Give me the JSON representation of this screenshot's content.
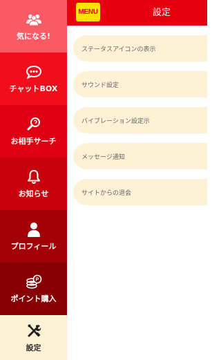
{
  "header": {
    "menu_label": "MENU",
    "title": "設定"
  },
  "colors": {
    "accent": "#e6000f",
    "menu_button": "#ffe100",
    "row_bg": "#fdf1d6",
    "active_nav_bg": "#fdf1d6"
  },
  "sidebar": {
    "items": [
      {
        "label": "気になる!",
        "icon": "people-icon",
        "bg": "#f95b65"
      },
      {
        "label": "チャットBOX",
        "icon": "chat-bubble-icon",
        "bg": "#f10d1c"
      },
      {
        "label": "お相手サーチ",
        "icon": "search-icon",
        "bg": "#de0010"
      },
      {
        "label": "お知らせ",
        "icon": "bell-icon",
        "bg": "#c8000c"
      },
      {
        "label": "プロフィール",
        "icon": "user-icon",
        "bg": "#a30007"
      },
      {
        "label": "ポイント購入",
        "icon": "coins-icon",
        "bg": "#860004"
      },
      {
        "label": "設定",
        "icon": "tools-icon",
        "bg": "#fdf1d6",
        "active": true
      }
    ]
  },
  "settings": {
    "rows": [
      {
        "label": "ステータスアイコンの表示"
      },
      {
        "label": "サウンド設定"
      },
      {
        "label": "バイブレーション設定示"
      },
      {
        "label": "メッセージ通知"
      },
      {
        "label": "サイトからの退会"
      }
    ]
  }
}
